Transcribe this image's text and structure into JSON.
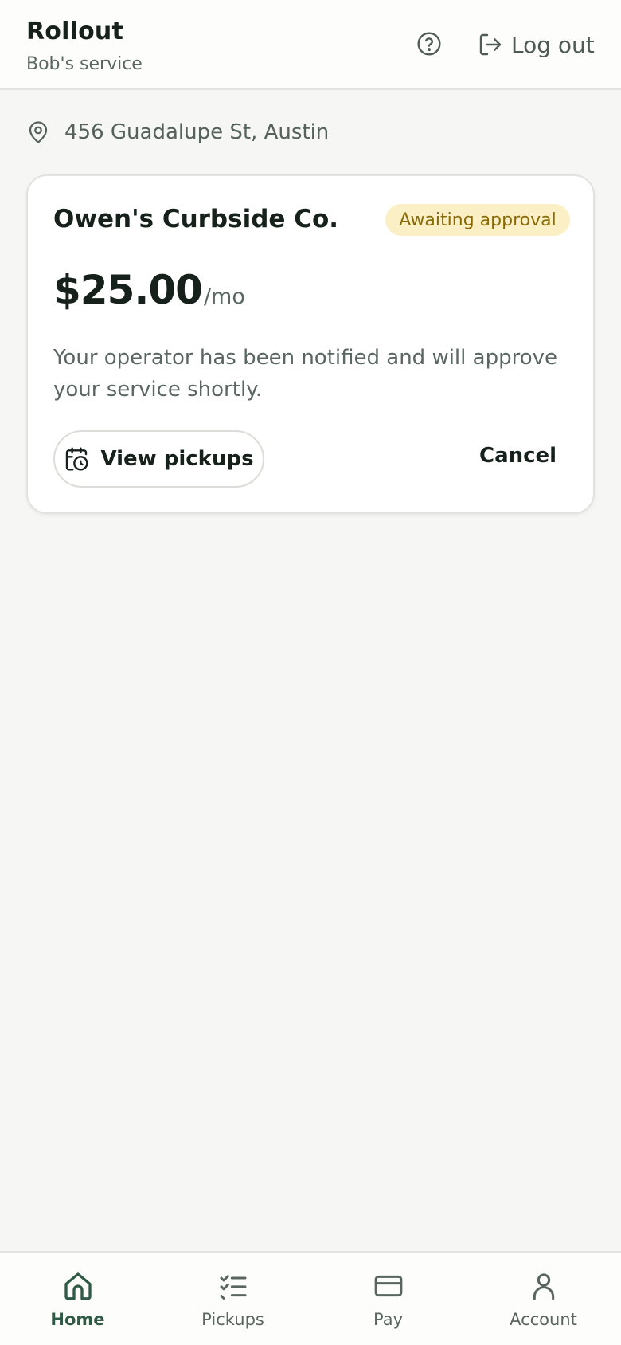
{
  "header": {
    "app_name": "Rollout",
    "subtitle": "Bob's service",
    "help_icon": "help-circle-icon",
    "logout_label": "Log out",
    "logout_icon": "log-out-icon"
  },
  "address": {
    "icon": "map-pin-icon",
    "text": "456 Guadalupe St, Austin"
  },
  "service_card": {
    "provider_name": "Owen's Curbside Co.",
    "status_badge": "Awaiting approval",
    "price": "$25.00",
    "period": "/mo",
    "notice": "Your operator has been notified and will approve your service shortly.",
    "view_pickups_label": "View pickups",
    "view_pickups_icon": "calendar-clock-icon",
    "cancel_label": "Cancel"
  },
  "bottom_nav": {
    "items": [
      {
        "label": "Home",
        "icon": "home-icon",
        "active": true
      },
      {
        "label": "Pickups",
        "icon": "checklist-icon",
        "active": false
      },
      {
        "label": "Pay",
        "icon": "credit-card-icon",
        "active": false
      },
      {
        "label": "Account",
        "icon": "user-icon",
        "active": false
      }
    ]
  },
  "colors": {
    "background": "#f6f6f4",
    "card": "#ffffff",
    "text_primary": "#17211c",
    "text_secondary": "#5a6661",
    "badge_bg": "#fbefc6",
    "badge_text": "#8a6a05",
    "nav_active": "#2f5a45"
  }
}
